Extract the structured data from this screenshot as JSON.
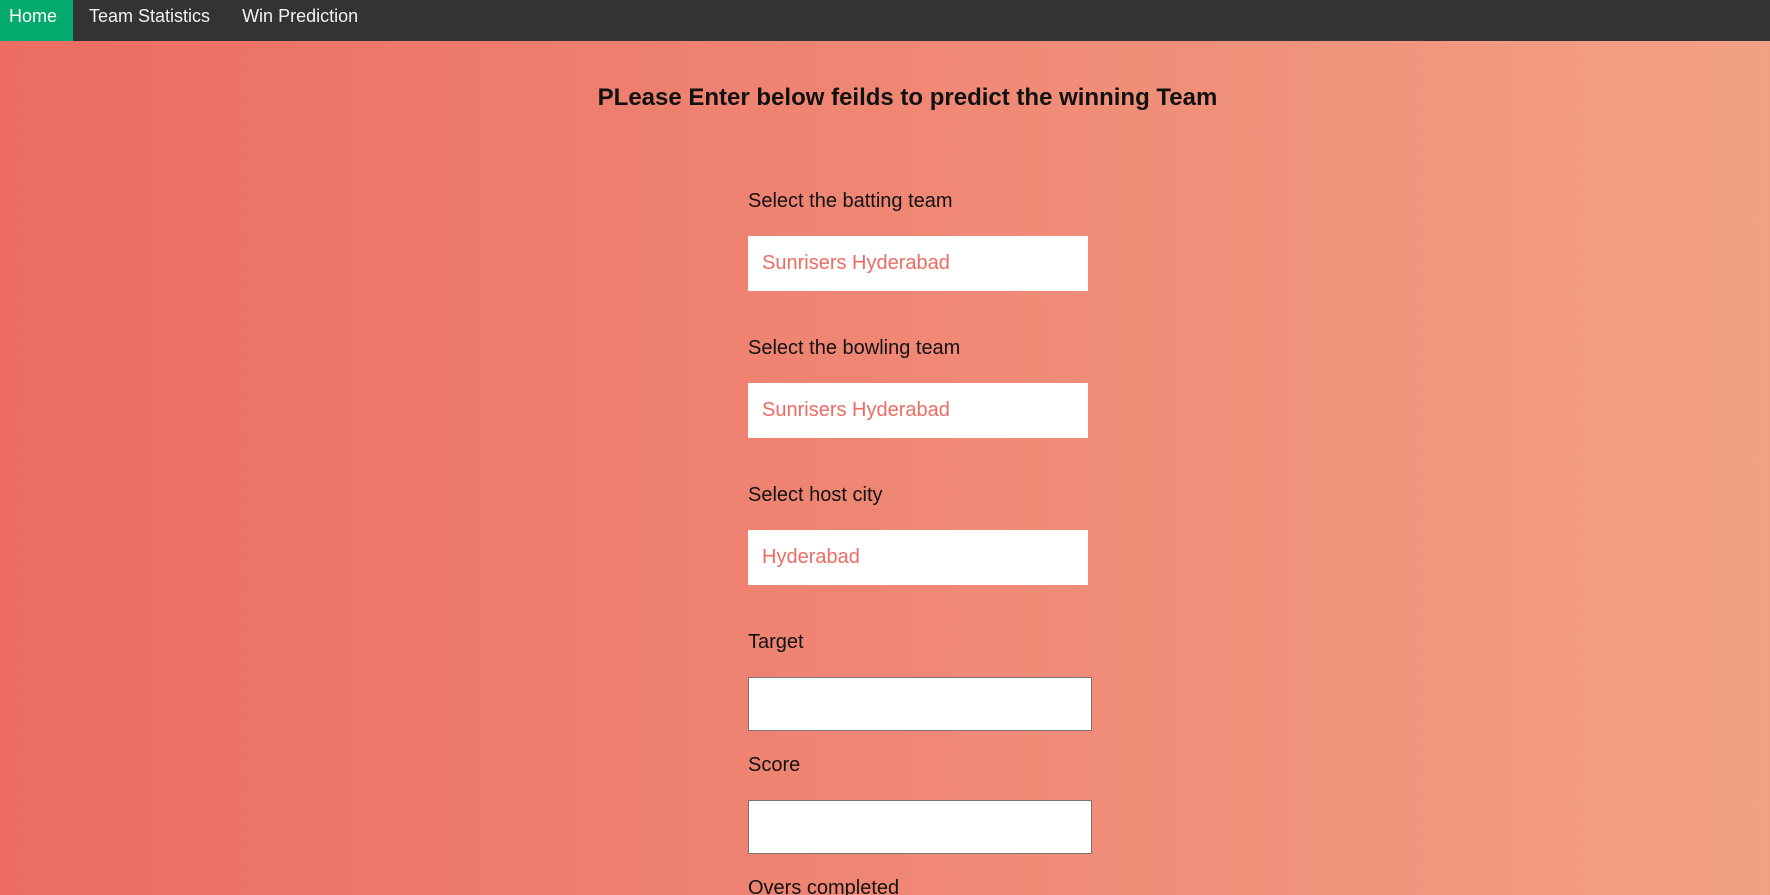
{
  "nav": {
    "items": [
      {
        "label": "Home",
        "active": true
      },
      {
        "label": "Team Statistics",
        "active": false
      },
      {
        "label": "Win Prediction",
        "active": false
      }
    ]
  },
  "colors": {
    "nav_bg": "#333333",
    "nav_active": "#04aa6d",
    "gradient_start": "#ec6c63",
    "gradient_end": "#f2a184",
    "select_text": "#ec6c63"
  },
  "page": {
    "heading": "PLease Enter below feilds to predict the winning Team"
  },
  "form": {
    "batting_label": "Select the batting team",
    "batting_value": "Sunrisers Hyderabad",
    "bowling_label": "Select the bowling team",
    "bowling_value": "Sunrisers Hyderabad",
    "city_label": "Select host city",
    "city_value": "Hyderabad",
    "target_label": "Target",
    "target_value": "",
    "score_label": "Score",
    "score_value": "",
    "overs_label": "Overs completed"
  }
}
